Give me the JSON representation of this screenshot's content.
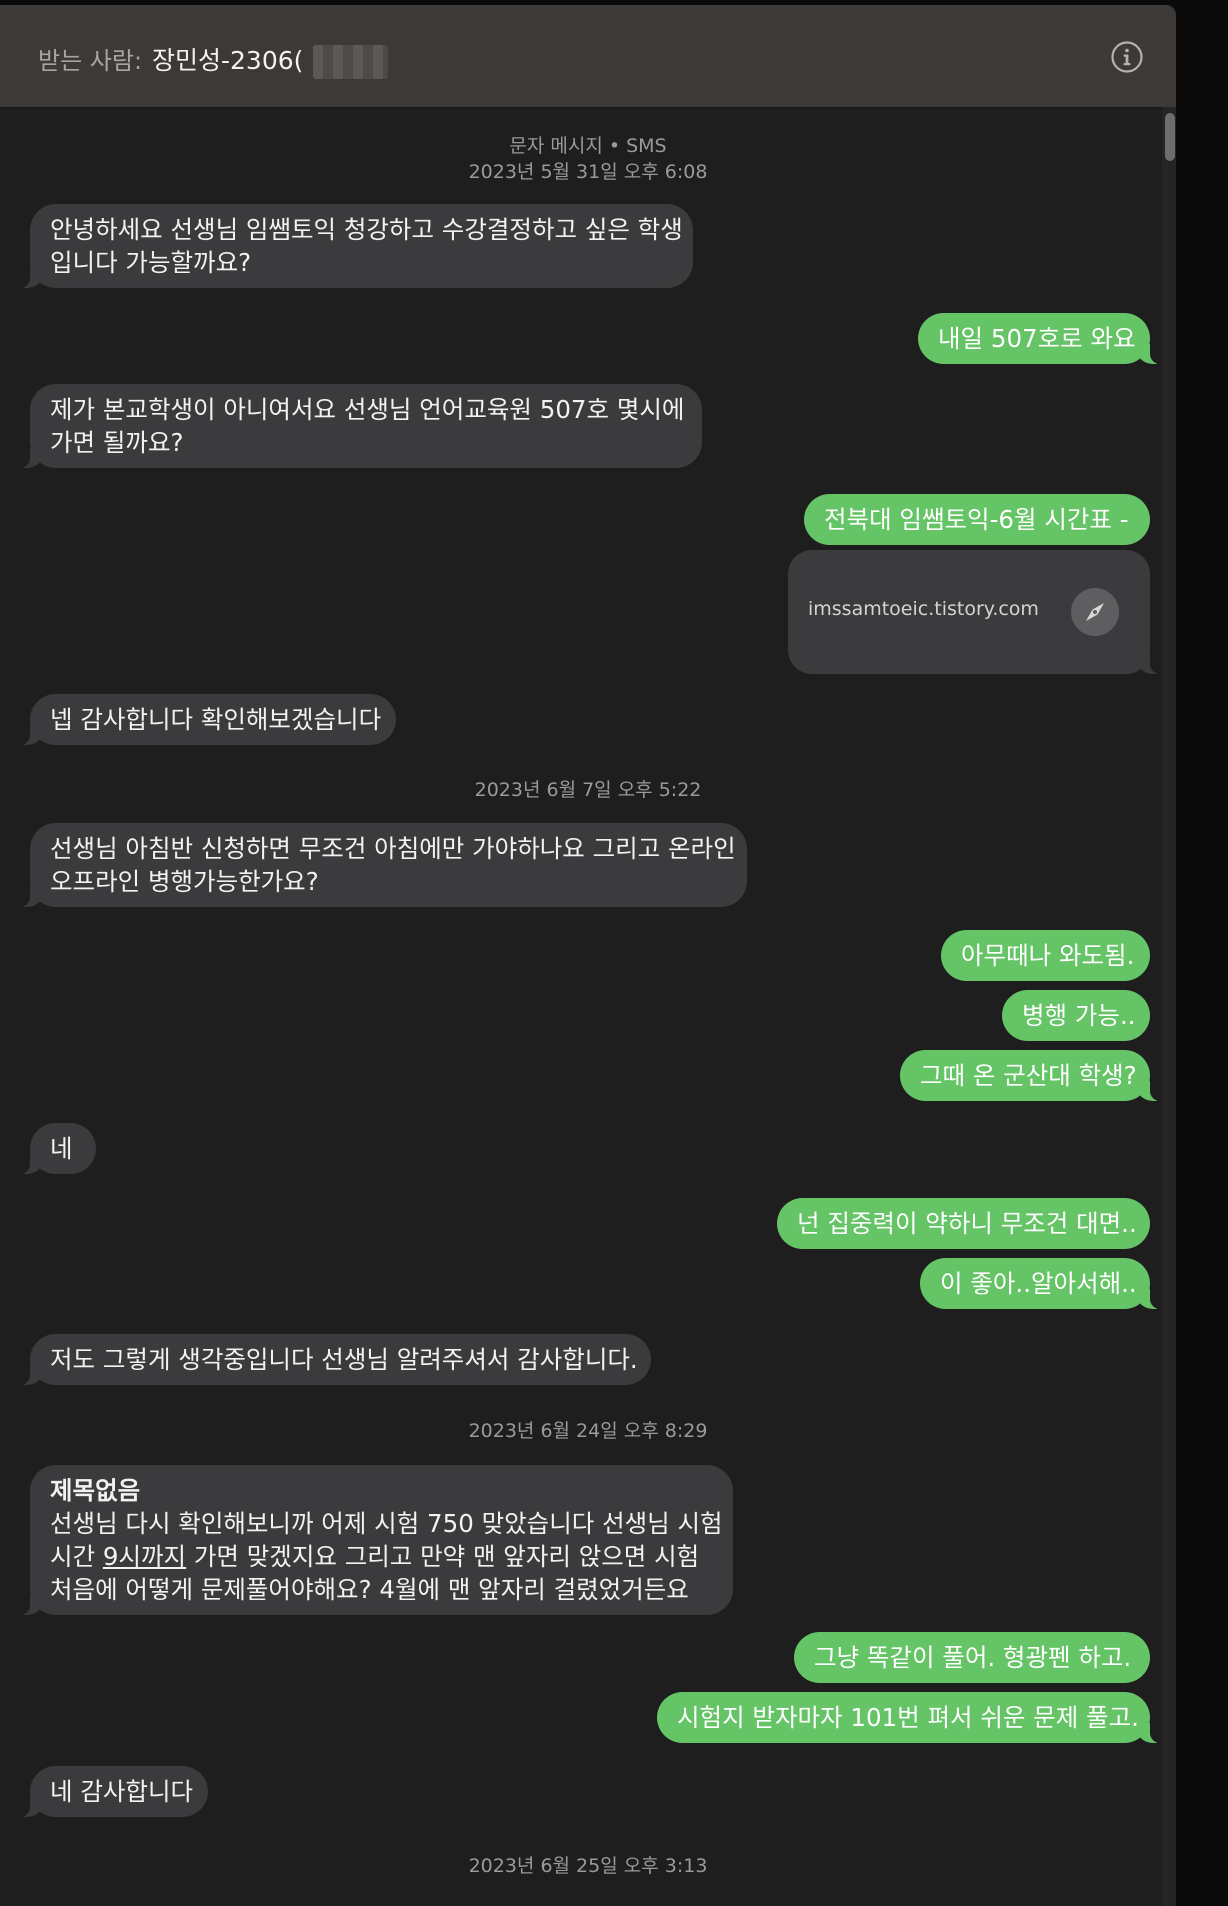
{
  "header": {
    "recipient_label": "받는 사람:",
    "recipient_name": "장민성-2306(",
    "info_icon": "info-icon"
  },
  "thread": {
    "service_label": "문자 메시지 • SMS",
    "timestamps": [
      "2023년 5월 31일 오후 6:08",
      "2023년 6월 7일 오후 5:22",
      "2023년 6월 24일 오후 8:29",
      "2023년 6월 25일 오후 3:13"
    ],
    "messages": {
      "m1": [
        "안녕하세요 선생님 임쌤토익 청강하고 수강결정하고 싶은 학생",
        "입니다 가능할까요?"
      ],
      "m2": "내일 507호로 와요",
      "m3": [
        "제가 본교학생이 아니여서요 선생님 언어교육원 507호 몇시에",
        "가면 될까요?"
      ],
      "m4": "전북대 임쌤토익-6월 시간표 -",
      "link_card": {
        "domain": "imssamtoeic.tistory.com",
        "icon": "compass-icon"
      },
      "m5": "넵 감사합니다 확인해보겠습니다",
      "m6": [
        "선생님 아침반 신청하면 무조건 아침에만 가야하나요 그리고 온라인",
        "오프라인 병행가능한가요?"
      ],
      "m7": "아무때나 와도됨.",
      "m8": "병행 가능..",
      "m9": "그때 온 군산대 학생?",
      "m10": "네",
      "m11": "넌 집중력이 약하니 무조건 대면..",
      "m12": "이 좋아..알아서해..",
      "m13": "저도 그렇게 생각중입니다 선생님 알려주셔서 감사합니다.",
      "m14": {
        "subject": "제목없음",
        "line1": "선생님 다시 확인해보니까 어제 시험 750 맞았습니다 선생님 시험",
        "line2_pre": "시간 ",
        "line2_underlined": "9시까지",
        "line2_post": " 가면 맞겠지요 그리고 만약 맨 앞자리 앉으면 시험",
        "line3": "처음에 어떻게 문제풀어야해요? 4월에 맨 앞자리 걸렸었거든요"
      },
      "m15": "그냥 똑같이 풀어. 형광펜 하고.",
      "m16": "시험지 받자마자 101번 펴서 쉬운 문제 풀고.",
      "m17": "네 감사합니다"
    }
  },
  "colors": {
    "incoming_bubble": "#3b3b3d",
    "outgoing_bubble": "#65c466",
    "background": "#1e1e1e",
    "header": "#3d3937"
  }
}
